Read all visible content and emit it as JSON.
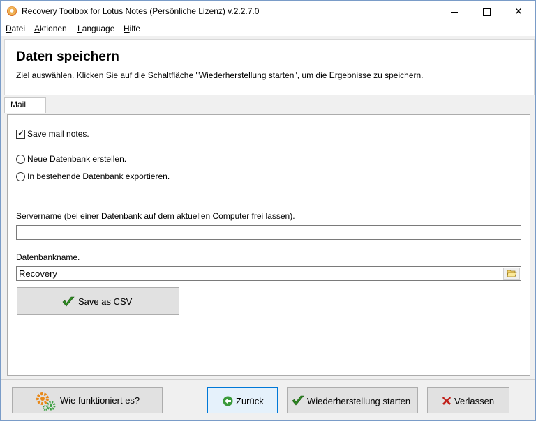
{
  "window": {
    "title": "Recovery Toolbox for Lotus Notes (Persönliche Lizenz) v.2.2.7.0",
    "controls": {
      "minimize": "",
      "maximize": "",
      "close": "✕"
    }
  },
  "menu": {
    "items": [
      {
        "label_u": "D",
        "label_rest": "atei"
      },
      {
        "label_u": "A",
        "label_rest": "ktionen"
      },
      {
        "label_u": "L",
        "label_rest": "anguage"
      },
      {
        "label_u": "H",
        "label_rest": "ilfe"
      }
    ]
  },
  "header": {
    "title": "Daten speichern",
    "subtitle": "Ziel auswählen. Klicken Sie auf die Schaltfläche \"Wiederherstellung starten\", um die Ergebnisse zu speichern."
  },
  "tabs": [
    {
      "label": "Mail",
      "active": true
    }
  ],
  "form": {
    "save_notes_label": "Save mail notes.",
    "save_notes_checked": true,
    "radio_new_label": "Neue Datenbank erstellen.",
    "radio_export_label": "In bestehende Datenbank exportieren.",
    "server_label": "Servername (bei einer Datenbank auf dem aktuellen Computer frei lassen).",
    "server_value": "",
    "dbname_label": "Datenbankname.",
    "dbname_value": "Recovery",
    "save_csv_label": "Save as CSV"
  },
  "footer": {
    "help_label": "Wie funktioniert es?",
    "back_label": "Zurück",
    "start_label": "Wiederherstellung starten",
    "exit_label": "Verlassen"
  },
  "colors": {
    "check_green": "#2e8b22",
    "exit_red": "#c0201a",
    "back_green": "#3a9a3a",
    "gear_orange": "#e8891a",
    "gear_green": "#3aa040",
    "focus_blue": "#0078d7"
  }
}
